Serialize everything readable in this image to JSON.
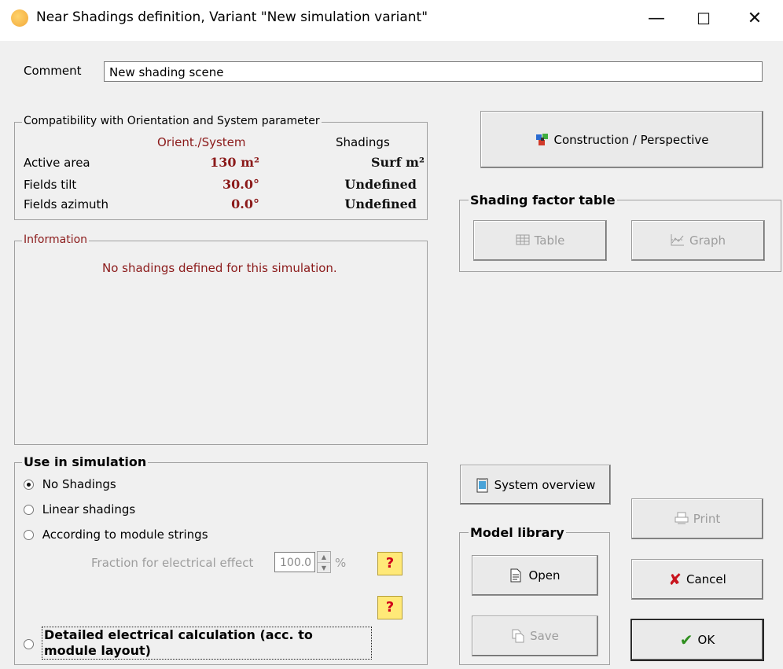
{
  "window": {
    "title": "Near Shadings definition, Variant \"New simulation variant\"",
    "minimize": "—",
    "maximize": "☐",
    "close": "✕"
  },
  "comment": {
    "label": "Comment",
    "value": "New shading scene"
  },
  "compat": {
    "title": "Compatibility with Orientation and System parameter",
    "col_orient": "Orient./System",
    "col_shadings": "Shadings",
    "rows": [
      {
        "label": "Active area",
        "orient": "130 m²",
        "shadings": "Surf m²"
      },
      {
        "label": "Fields tilt",
        "orient": "30.0°",
        "shadings": "Undefined"
      },
      {
        "label": "Fields azimuth",
        "orient": "0.0°",
        "shadings": "Undefined"
      }
    ]
  },
  "information": {
    "title": "Information",
    "message": "No shadings defined for this simulation."
  },
  "use_sim": {
    "title": "Use in simulation",
    "options": [
      "No Shadings",
      "Linear shadings",
      "According to module strings"
    ],
    "selected": 0,
    "fraction_label": "Fraction for electrical effect",
    "fraction_value": "100.0",
    "fraction_unit": "%",
    "help": "?",
    "detailed": "Detailed electrical calculation (acc. to module layout)"
  },
  "buttons": {
    "construction": "Construction / Perspective",
    "table": "Table",
    "graph": "Graph",
    "system_overview": "System overview",
    "print": "Print",
    "open": "Open",
    "save": "Save",
    "cancel": "Cancel",
    "ok": "OK"
  },
  "shading_table": {
    "title": "Shading factor table"
  },
  "model_library": {
    "title": "Model library"
  },
  "colors": {
    "accent_red": "#8b1a1a",
    "ok_green": "#2f8f1f",
    "cancel_red": "#c8141e"
  }
}
